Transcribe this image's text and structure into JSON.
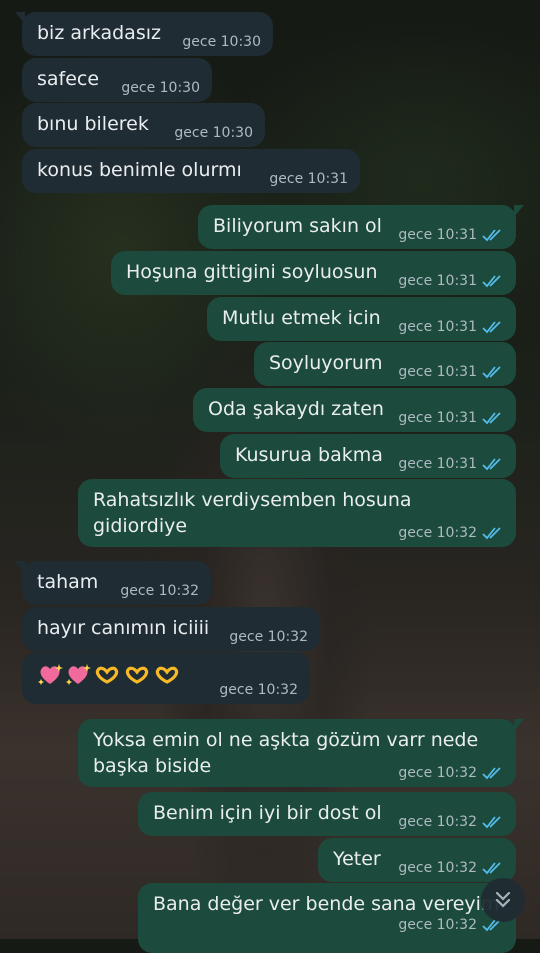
{
  "colors": {
    "incoming_bubble": "#202c33",
    "outgoing_bubble": "#1c4a3c",
    "text": "#e9edef",
    "meta": "#aebac1",
    "read_ticks": "#53bdeb"
  },
  "messages": [
    {
      "dir": "in",
      "text": "biz arkadasız",
      "time": "gece 10:30"
    },
    {
      "dir": "in",
      "text": "safece",
      "time": "gece 10:30"
    },
    {
      "dir": "in",
      "text": "bınu bilerek",
      "time": "gece 10:30"
    },
    {
      "dir": "in",
      "text": "konus benimle olurmı",
      "time": "gece 10:31"
    },
    {
      "dir": "out",
      "text": "Biliyorum sakın ol",
      "time": "gece 10:31",
      "status_icon": "double-check-read-icon"
    },
    {
      "dir": "out",
      "text": "Hoşuna gittigini soyluosun",
      "time": "gece 10:31",
      "status_icon": "double-check-read-icon"
    },
    {
      "dir": "out",
      "text": "Mutlu etmek icin",
      "time": "gece 10:31",
      "status_icon": "double-check-read-icon"
    },
    {
      "dir": "out",
      "text": "Soyluyorum",
      "time": "gece 10:31",
      "status_icon": "double-check-read-icon"
    },
    {
      "dir": "out",
      "text": "Oda şakaydı zaten",
      "time": "gece 10:31",
      "status_icon": "double-check-read-icon"
    },
    {
      "dir": "out",
      "text": "Kusurua bakma",
      "time": "gece 10:31",
      "status_icon": "double-check-read-icon"
    },
    {
      "dir": "out",
      "text": "Rahatsızlık verdiysemben hosuna\ngidiordiye",
      "time": "gece 10:32",
      "status_icon": "double-check-read-icon"
    },
    {
      "dir": "in",
      "text": "taham",
      "time": "gece 10:32"
    },
    {
      "dir": "in",
      "text": "hayır canımın iciiii",
      "time": "gece 10:32"
    },
    {
      "dir": "in",
      "emoji": [
        "sparkling-heart-icon",
        "sparkling-heart-icon",
        "heart-hands-icon",
        "heart-hands-icon",
        "heart-hands-icon"
      ],
      "time": "gece 10:32"
    },
    {
      "dir": "out",
      "text": "Yoksa emin ol ne aşkta gözüm varr nede\nbaşka biside",
      "time": "gece 10:32",
      "status_icon": "double-check-read-icon"
    },
    {
      "dir": "out",
      "text": "Benim için iyi bir dost ol",
      "time": "gece 10:32",
      "status_icon": "double-check-read-icon"
    },
    {
      "dir": "out",
      "text": "Yeter",
      "time": "gece 10:32",
      "status_icon": "double-check-read-icon"
    },
    {
      "dir": "out",
      "text": "Bana değer ver bende sana vereyim",
      "time": "gece 10:32",
      "status_icon": "double-check-read-icon"
    }
  ],
  "scroll_button": {
    "icon": "double-chevron-down-icon"
  }
}
